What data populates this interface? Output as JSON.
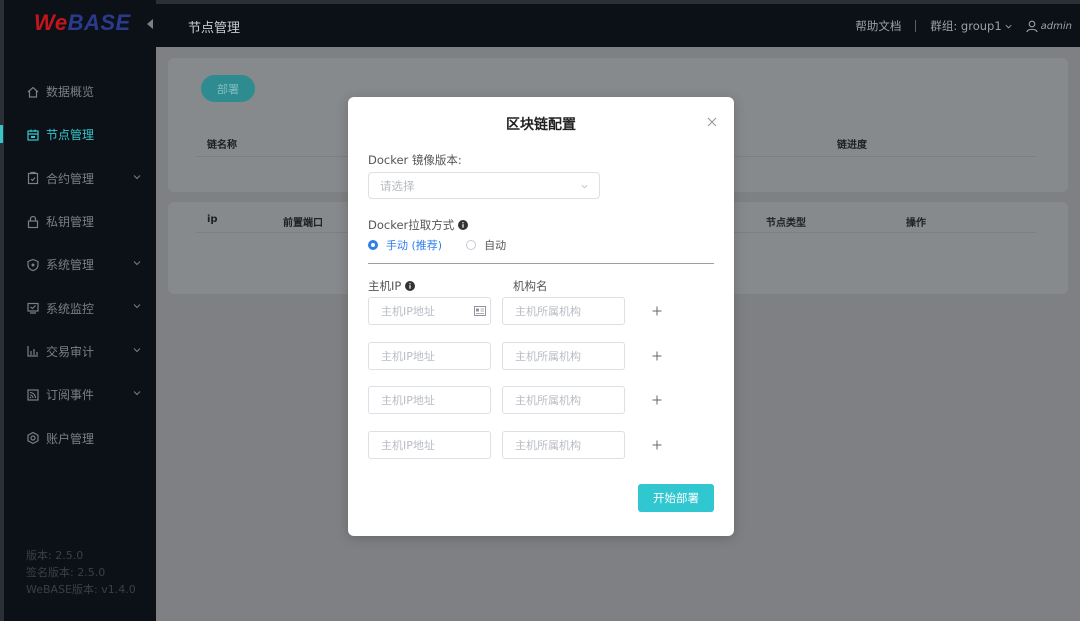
{
  "logo": {
    "w": "We",
    "rest": "BASE"
  },
  "header": {
    "title": "节点管理",
    "help": "帮助文档",
    "group_label": "群组: group1",
    "user": "admin"
  },
  "sidebar": {
    "items": [
      {
        "label": "数据概览",
        "icon": "home-icon",
        "has_arrow": false
      },
      {
        "label": "节点管理",
        "icon": "calendar-icon",
        "has_arrow": false,
        "active": true
      },
      {
        "label": "合约管理",
        "icon": "clipboard-icon",
        "has_arrow": true
      },
      {
        "label": "私钥管理",
        "icon": "lock-icon",
        "has_arrow": false
      },
      {
        "label": "系统管理",
        "icon": "shield-icon",
        "has_arrow": true
      },
      {
        "label": "系统监控",
        "icon": "monitor-icon",
        "has_arrow": true
      },
      {
        "label": "交易审计",
        "icon": "bar-chart-icon",
        "has_arrow": true
      },
      {
        "label": "订阅事件",
        "icon": "rss-icon",
        "has_arrow": true
      },
      {
        "label": "账户管理",
        "icon": "settings-icon",
        "has_arrow": false
      }
    ],
    "versions": [
      "版本: 2.5.0",
      "签名版本: 2.5.0",
      "WeBASE版本: v1.4.0"
    ]
  },
  "main": {
    "deploy_button": "部署",
    "table1_headers": [
      "链名称",
      "链进度"
    ],
    "table2_headers": [
      "ip",
      "前置端口",
      "节点类型",
      "操作"
    ]
  },
  "modal": {
    "title": "区块链配置",
    "docker_version_label": "Docker 镜像版本:",
    "select_placeholder": "请选择",
    "pull_mode_label": "Docker拉取方式",
    "radio_manual": "手动 (推荐)",
    "radio_auto": "自动",
    "host_ip_label": "主机IP",
    "org_name_label": "机构名",
    "ip_placeholder": "主机IP地址",
    "org_placeholder": "主机所属机构",
    "start_button": "开始部署"
  },
  "colors": {
    "accent": "#37c5c9",
    "primary_radio": "#2f7eea",
    "start_button": "#30c7d1"
  }
}
